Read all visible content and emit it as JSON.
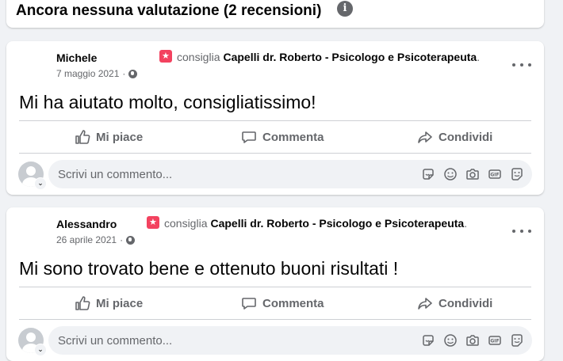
{
  "header": {
    "title": "Ancora nessuna valutazione (2 recensioni)",
    "info_icon": "info-icon"
  },
  "reviews": [
    {
      "author": "Michele",
      "recommend_verb": "consiglia",
      "page": "Capelli dr. Roberto - Psicologo e Psicoterapeuta",
      "page_suffix": ".",
      "date": "7 maggio 2021",
      "dot": "·",
      "text": "Mi ha aiutato molto, consigliatissimo!",
      "actions": {
        "like": "Mi piace",
        "comment": "Commenta",
        "share": "Condividi"
      },
      "comment_placeholder": "Scrivi un commento..."
    },
    {
      "author": "Alessandro",
      "recommend_verb": "consiglia",
      "page": "Capelli dr. Roberto - Psicologo e Psicoterapeuta",
      "page_suffix": ".",
      "date": "26 aprile 2021",
      "dot": "·",
      "text": "Mi sono trovato bene e ottenuto buoni risultati !",
      "actions": {
        "like": "Mi piace",
        "comment": "Commenta",
        "share": "Condividi"
      },
      "comment_placeholder": "Scrivi un commento..."
    }
  ],
  "colors": {
    "recommend_badge": "#f3425f",
    "secondary_text": "#65676b",
    "background": "#f0f2f5"
  },
  "icons": [
    "info-icon",
    "recommend-icon",
    "globe-icon",
    "more-icon",
    "like-icon",
    "comment-icon",
    "share-icon",
    "sticker-icon",
    "emoji-icon",
    "camera-icon",
    "gif-icon",
    "avatar-sticker-icon"
  ]
}
